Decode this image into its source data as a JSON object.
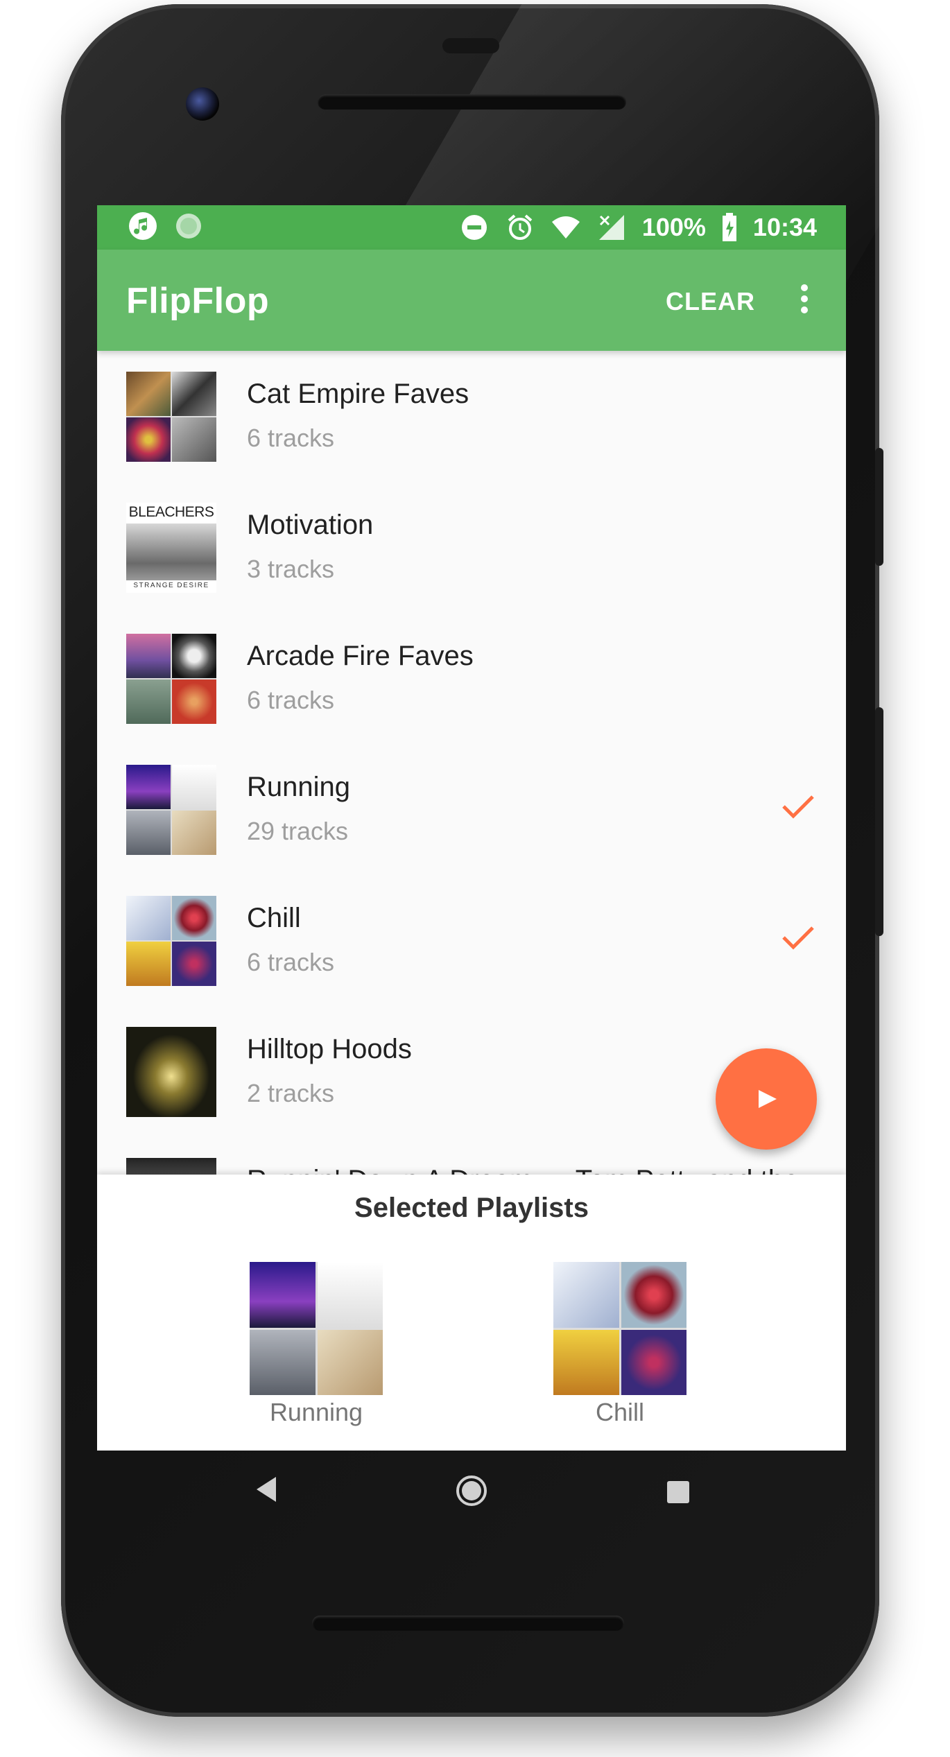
{
  "status_bar": {
    "battery": "100%",
    "time": "10:34"
  },
  "app_bar": {
    "title": "FlipFlop",
    "clear_label": "CLEAR"
  },
  "playlists": [
    {
      "title": "Cat Empire Faves",
      "subtitle": "6 tracks",
      "selected": false,
      "art": [
        "#8a6a3a",
        "#4a4a4a",
        "#c04060",
        "#9a9a9a"
      ]
    },
    {
      "title": "Motivation",
      "subtitle": "3 tracks",
      "selected": false,
      "art_text": "BLEACHERS",
      "art_caption": "STRANGE DESIRE"
    },
    {
      "title": "Arcade Fire Faves",
      "subtitle": "6 tracks",
      "selected": false,
      "art": [
        "#b06aa0",
        "#2a2a2a",
        "#6a8a70",
        "#c8503a"
      ]
    },
    {
      "title": "Running",
      "subtitle": "29 tracks",
      "selected": true,
      "art": [
        "#3a2a9a",
        "#e8e8e8",
        "#8a8f98",
        "#c8b89a"
      ]
    },
    {
      "title": "Chill",
      "subtitle": "6 tracks",
      "selected": true,
      "art": [
        "#e8eef5",
        "#8a9ab0",
        "#e8b030",
        "#4a3a7a"
      ]
    },
    {
      "title": "Hilltop Hoods",
      "subtitle": "2 tracks",
      "selected": false,
      "art_single": "#1a1a10"
    },
    {
      "title": "Runnin' Down A Dream — Tom Petty and the",
      "subtitle": "",
      "selected": false,
      "art_single": "#e8e0d0"
    }
  ],
  "selected_panel": {
    "title": "Selected Playlists",
    "items": [
      {
        "label": "Running",
        "art": [
          "#3a2a9a",
          "#e8e8e8",
          "#8a8f98",
          "#c8b89a"
        ]
      },
      {
        "label": "Chill",
        "art": [
          "#e8eef5",
          "#8a9ab0",
          "#e8b030",
          "#4a3a7a"
        ]
      }
    ]
  },
  "colors": {
    "status_bar": "#4caf50",
    "app_bar": "#66bb6a",
    "accent": "#ff7043"
  }
}
